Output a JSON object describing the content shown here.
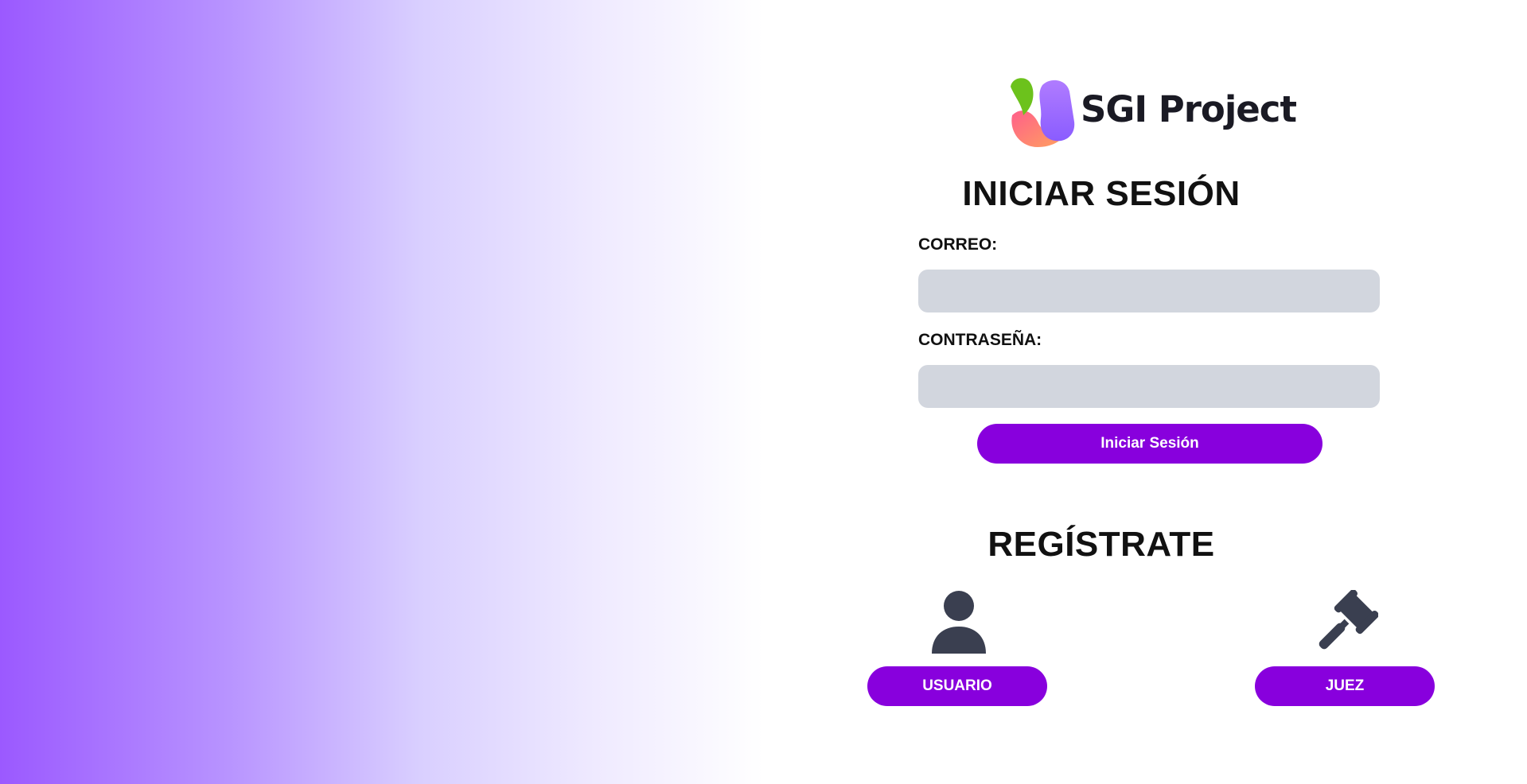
{
  "brand": {
    "name": "SGI Project",
    "logo_icon": "sgi-logo-icon",
    "colors": {
      "logo_green": "#6cc21c",
      "logo_pink": "#ff6f7d",
      "logo_purple": "#9b6bff",
      "text": "#1a1a24"
    }
  },
  "login": {
    "title": "INICIAR SESIÓN",
    "email_label": "CORREO:",
    "email_value": "",
    "email_placeholder": "",
    "password_label": "CONTRASEÑA:",
    "password_value": "",
    "password_placeholder": "",
    "submit_label": "Iniciar Sesión"
  },
  "register": {
    "title": "REGÍSTRATE",
    "options": [
      {
        "label": "USUARIO",
        "icon": "user-icon"
      },
      {
        "label": "JUEZ",
        "icon": "gavel-icon"
      }
    ]
  },
  "theme": {
    "accent": "#8800dd",
    "input_bg": "#d2d6de",
    "icon_color": "#3a3f50",
    "gradient_start": "#9b59ff",
    "gradient_end": "#ffffff"
  }
}
